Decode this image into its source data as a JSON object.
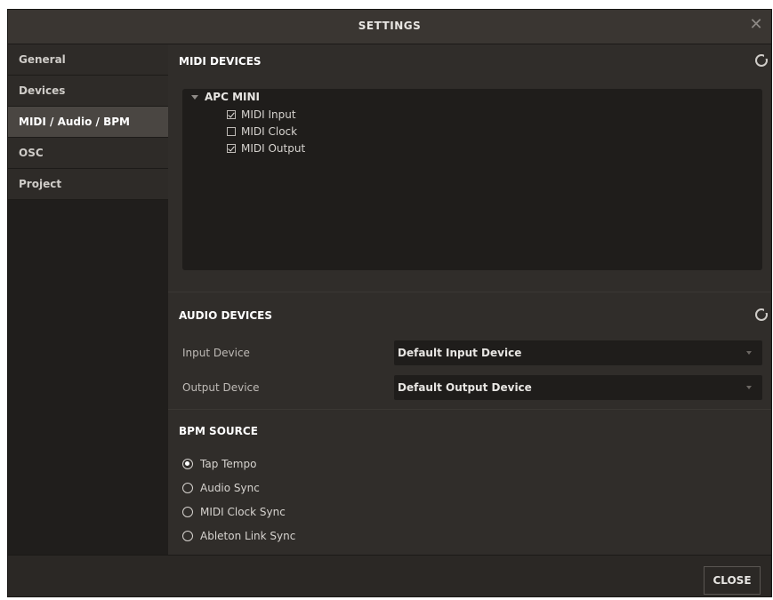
{
  "window": {
    "title": "SETTINGS",
    "close_glyph": "✕"
  },
  "sidebar": {
    "items": [
      {
        "label": "General"
      },
      {
        "label": "Devices"
      },
      {
        "label": "MIDI / Audio / BPM",
        "active": true
      },
      {
        "label": "OSC"
      },
      {
        "label": "Project"
      }
    ]
  },
  "midi_devices": {
    "title": "MIDI DEVICES",
    "refresh_icon": "refresh-icon",
    "device": {
      "name": "APC MINI",
      "options": [
        {
          "label": "MIDI Input",
          "checked": true
        },
        {
          "label": "MIDI Clock",
          "checked": false
        },
        {
          "label": "MIDI Output",
          "checked": true
        }
      ]
    }
  },
  "audio_devices": {
    "title": "AUDIO DEVICES",
    "refresh_icon": "refresh-icon",
    "input": {
      "label": "Input Device",
      "value": "Default Input Device"
    },
    "output": {
      "label": "Output Device",
      "value": "Default Output Device"
    }
  },
  "bpm_source": {
    "title": "BPM SOURCE",
    "options": [
      {
        "label": "Tap Tempo",
        "selected": true
      },
      {
        "label": "Audio Sync",
        "selected": false
      },
      {
        "label": "MIDI Clock Sync",
        "selected": false
      },
      {
        "label": "Ableton Link Sync",
        "selected": false
      }
    ]
  },
  "footer": {
    "close_label": "CLOSE"
  },
  "colors": {
    "background": "#2b2825",
    "panel": "#302d2a",
    "active_nav": "#4a4642",
    "field": "#1f1d1b"
  }
}
